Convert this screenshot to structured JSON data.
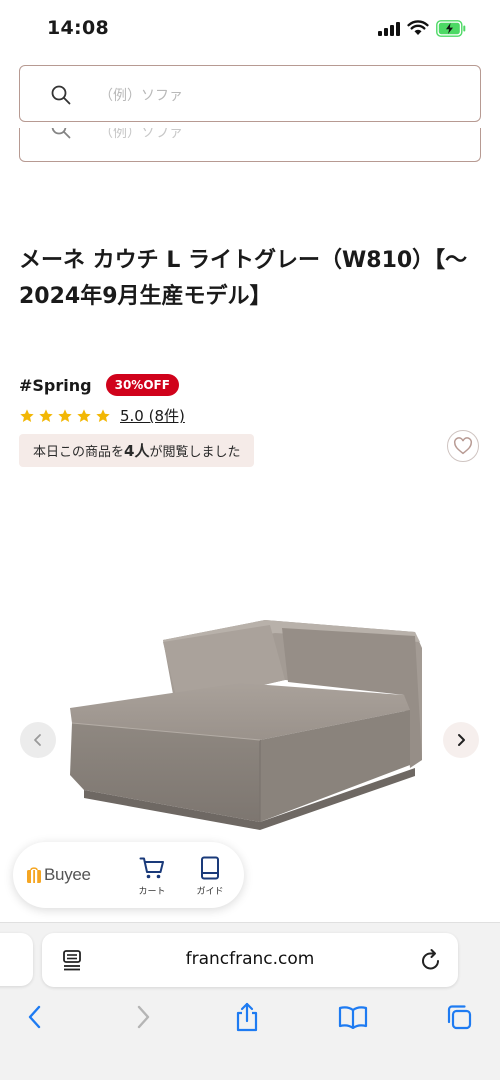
{
  "status": {
    "time": "14:08"
  },
  "search": {
    "placeholder": "（例）ソファ",
    "ghost_placeholder": "（例）ソファ"
  },
  "product": {
    "title": "メーネ カウチ L ライトグレー（W810）【〜2024年9月生産モデル】",
    "tag": "#Spring",
    "discount": "30%OFF",
    "rating_value": 5.0,
    "rating_text": "5.0 (8件)",
    "viewers_prefix": "本日この商品を",
    "viewers_count": "4人",
    "viewers_suffix": "が閲覧しました"
  },
  "buyee": {
    "brand": "Buyee",
    "cart_label": "カート",
    "guide_label": "ガイド"
  },
  "browser": {
    "url": "francfranc.com"
  },
  "colors": {
    "badge_red": "#d0021b",
    "star_gold": "#f2b705",
    "ios_blue": "#1e7bf2",
    "viewers_bg": "#f5ebe8",
    "search_border": "#b79a92"
  },
  "icons": {
    "search": "search-icon",
    "heart": "heart-icon",
    "prev": "chevron-left-icon",
    "next": "chevron-right-icon",
    "cart": "cart-icon",
    "guide": "book-icon",
    "reader": "reader-icon",
    "reload": "reload-icon",
    "back": "back-icon",
    "forward": "forward-icon",
    "share": "share-icon",
    "bookmarks": "bookmarks-icon",
    "tabs": "tabs-icon"
  }
}
